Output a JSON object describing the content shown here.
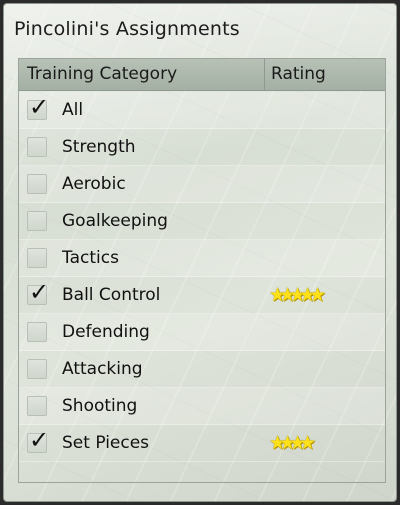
{
  "window": {
    "title": "Pincolini's Assignments"
  },
  "table": {
    "headers": {
      "category": "Training Category",
      "rating": "Rating"
    },
    "rows": [
      {
        "label": "All",
        "checked": true,
        "stars": 0
      },
      {
        "label": "Strength",
        "checked": false,
        "stars": 0
      },
      {
        "label": "Aerobic",
        "checked": false,
        "stars": 0
      },
      {
        "label": "Goalkeeping",
        "checked": false,
        "stars": 0
      },
      {
        "label": "Tactics",
        "checked": false,
        "stars": 0
      },
      {
        "label": "Ball Control",
        "checked": true,
        "stars": 5
      },
      {
        "label": "Defending",
        "checked": false,
        "stars": 0
      },
      {
        "label": "Attacking",
        "checked": false,
        "stars": 0
      },
      {
        "label": "Shooting",
        "checked": false,
        "stars": 0
      },
      {
        "label": "Set Pieces",
        "checked": true,
        "stars": 4
      }
    ]
  },
  "icons": {
    "check_glyph": "✓",
    "star_glyph": "★"
  }
}
